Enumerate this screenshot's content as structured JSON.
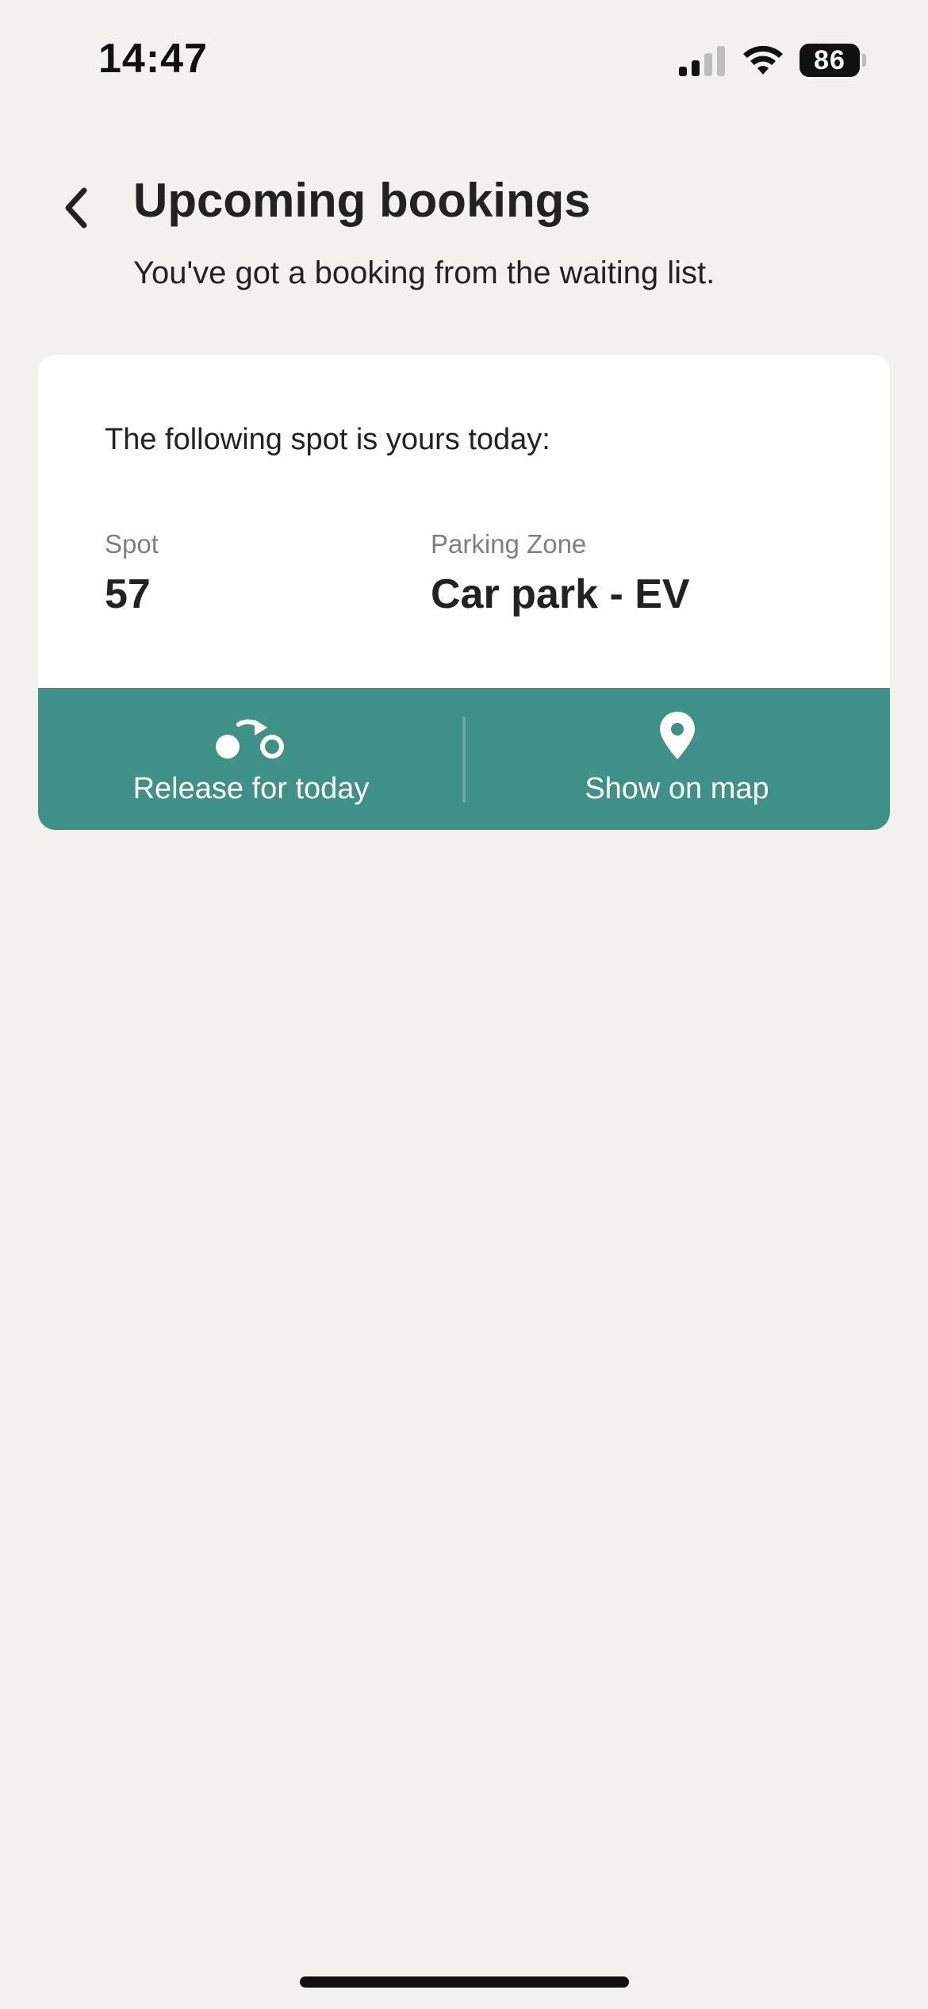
{
  "status_bar": {
    "time": "14:47",
    "battery_level": "86",
    "signal_bars_active": 2,
    "signal_bars_total": 4
  },
  "header": {
    "back_icon": "chevron-left-icon",
    "title": "Upcoming bookings",
    "subtitle": "You've got a booking from the waiting list."
  },
  "booking": {
    "intro": "The following spot is yours today:",
    "spot_label": "Spot",
    "spot_value": "57",
    "zone_label": "Parking Zone",
    "zone_value": "Car park - EV"
  },
  "actions": {
    "release_label": "Release for today",
    "release_icon": "release-arrow-icon",
    "map_label": "Show on map",
    "map_icon": "map-pin-icon"
  },
  "colors": {
    "background": "#f3f1ed",
    "card": "#ffffff",
    "accent": "#40908a",
    "text": "#222222",
    "label": "#7b7f86"
  }
}
